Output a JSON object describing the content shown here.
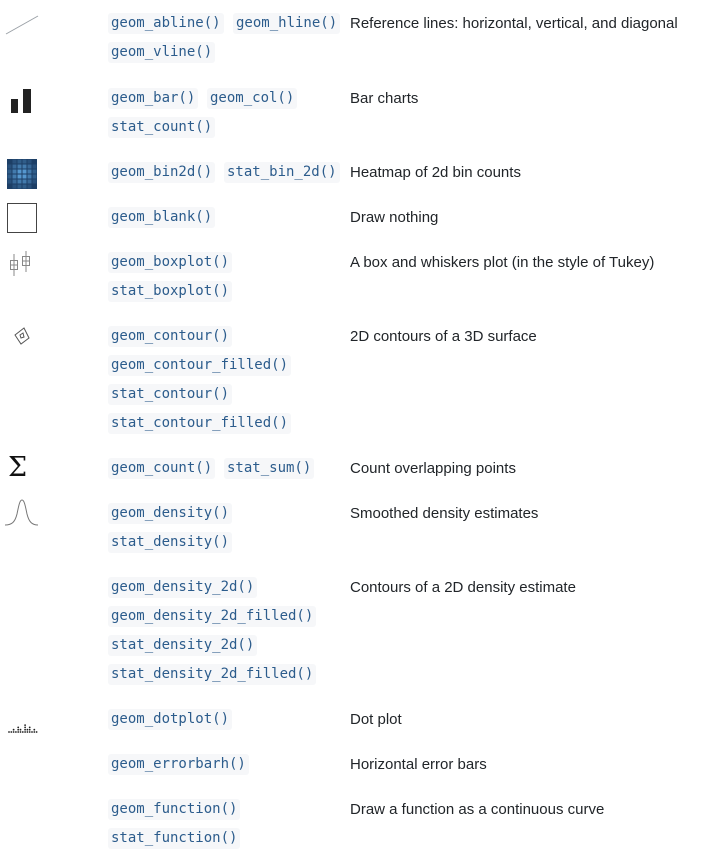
{
  "rows": [
    {
      "icon": "reference-lines-icon",
      "codes": [
        "geom_abline()",
        "geom_hline()",
        "geom_vline()"
      ],
      "description": "Reference lines: horizontal, vertical, and diagonal"
    },
    {
      "icon": "bar-chart-icon",
      "codes": [
        "geom_bar()",
        "geom_col()",
        "stat_count()"
      ],
      "description": "Bar charts"
    },
    {
      "icon": "heatmap-icon",
      "codes": [
        "geom_bin2d()",
        "stat_bin_2d()"
      ],
      "description": "Heatmap of 2d bin counts"
    },
    {
      "icon": "blank-square-icon",
      "codes": [
        "geom_blank()"
      ],
      "description": "Draw nothing"
    },
    {
      "icon": "boxplot-icon",
      "codes": [
        "geom_boxplot()",
        "stat_boxplot()"
      ],
      "description": "A box and whiskers plot (in the style of Tukey)"
    },
    {
      "icon": "contour-icon",
      "codes": [
        "geom_contour()",
        "geom_contour_filled()",
        "stat_contour()",
        "stat_contour_filled()"
      ],
      "description": "2D contours of a 3D surface"
    },
    {
      "icon": "sigma-icon",
      "codes": [
        "geom_count()",
        "stat_sum()"
      ],
      "description": "Count overlapping points"
    },
    {
      "icon": "density-curve-icon",
      "codes": [
        "geom_density()",
        "stat_density()"
      ],
      "description": "Smoothed density estimates"
    },
    {
      "icon": "",
      "codes": [
        "geom_density_2d()",
        "geom_density_2d_filled()",
        "stat_density_2d()",
        "stat_density_2d_filled()"
      ],
      "description": "Contours of a 2D density estimate"
    },
    {
      "icon": "dotplot-icon",
      "codes": [
        "geom_dotplot()"
      ],
      "description": "Dot plot"
    },
    {
      "icon": "",
      "codes": [
        "geom_errorbarh()"
      ],
      "description": "Horizontal error bars"
    },
    {
      "icon": "",
      "codes": [
        "geom_function()",
        "stat_function()"
      ],
      "description": "Draw a function as a continuous curve"
    }
  ],
  "icon_symbols": {
    "sigma": "Σ"
  }
}
